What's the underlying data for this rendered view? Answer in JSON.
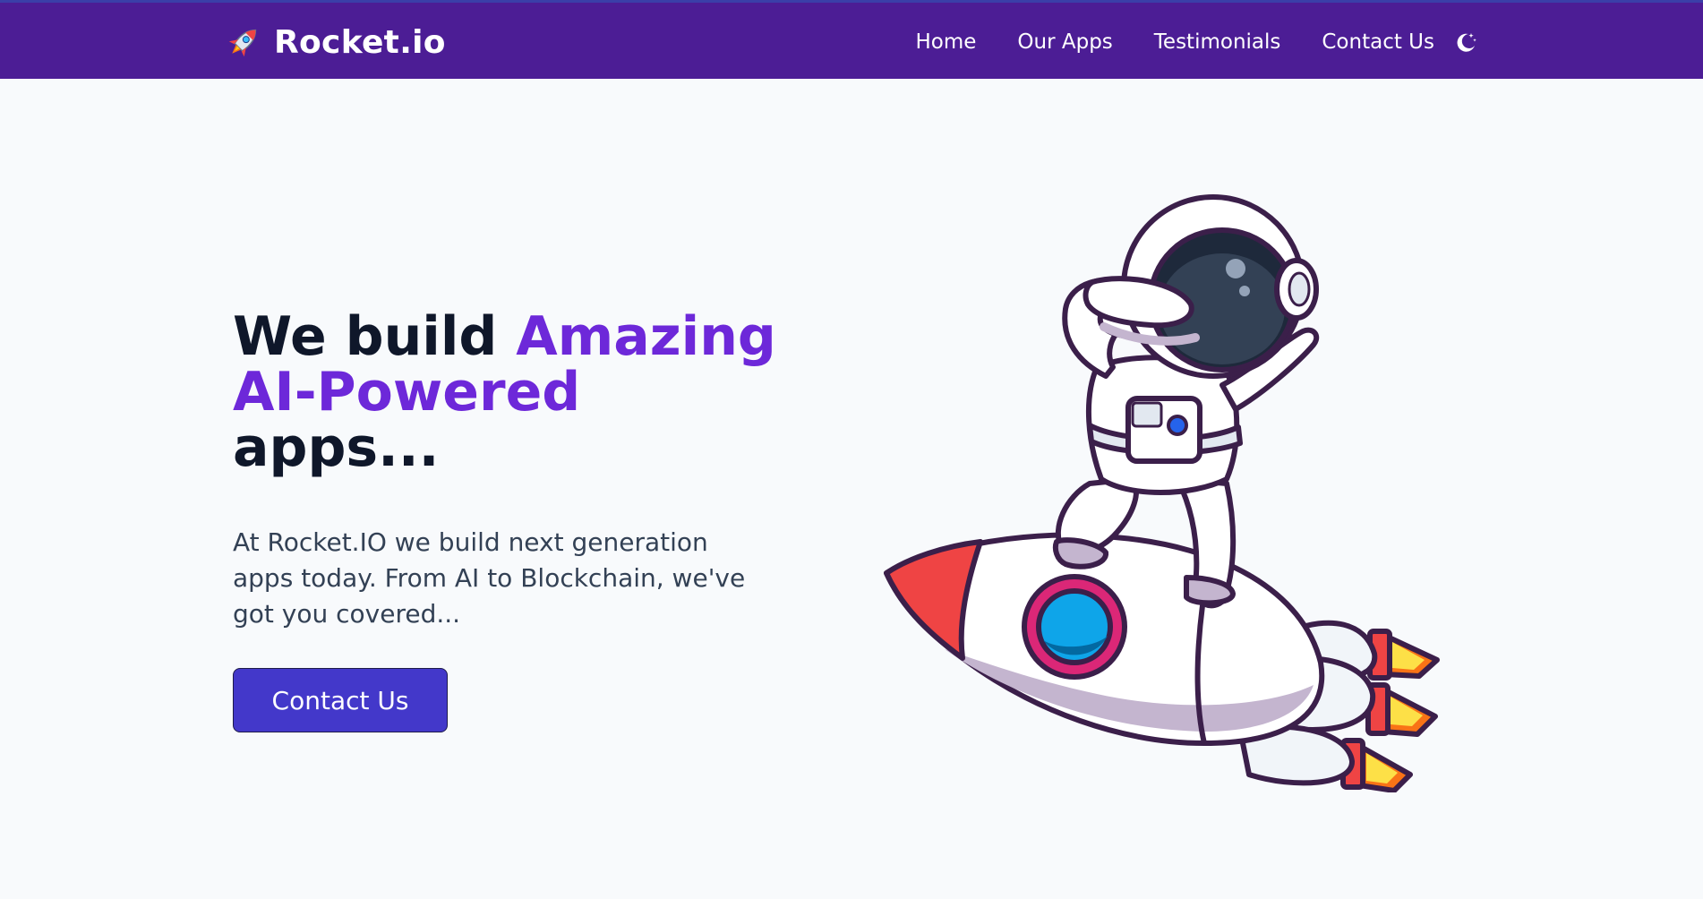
{
  "nav": {
    "brand": {
      "emoji": "🚀",
      "name": "Rocket.io"
    },
    "links": [
      {
        "label": "Home"
      },
      {
        "label": "Our Apps"
      },
      {
        "label": "Testimonials"
      },
      {
        "label": "Contact Us"
      }
    ],
    "theme_toggle_icon": "moon-stars-icon"
  },
  "hero": {
    "title_part1": "We build ",
    "title_accent": "Amazing AI-Powered",
    "title_part2": " apps...",
    "description": "At Rocket.IO we build next generation apps today. From AI to Blockchain, we've got you covered...",
    "cta_label": "Contact Us"
  },
  "colors": {
    "navbar": "#4c1d95",
    "accent": "#6d28d9",
    "button": "#4338ca",
    "background": "#f8fafc"
  },
  "illustration": {
    "icon": "astronaut-on-rocket"
  }
}
